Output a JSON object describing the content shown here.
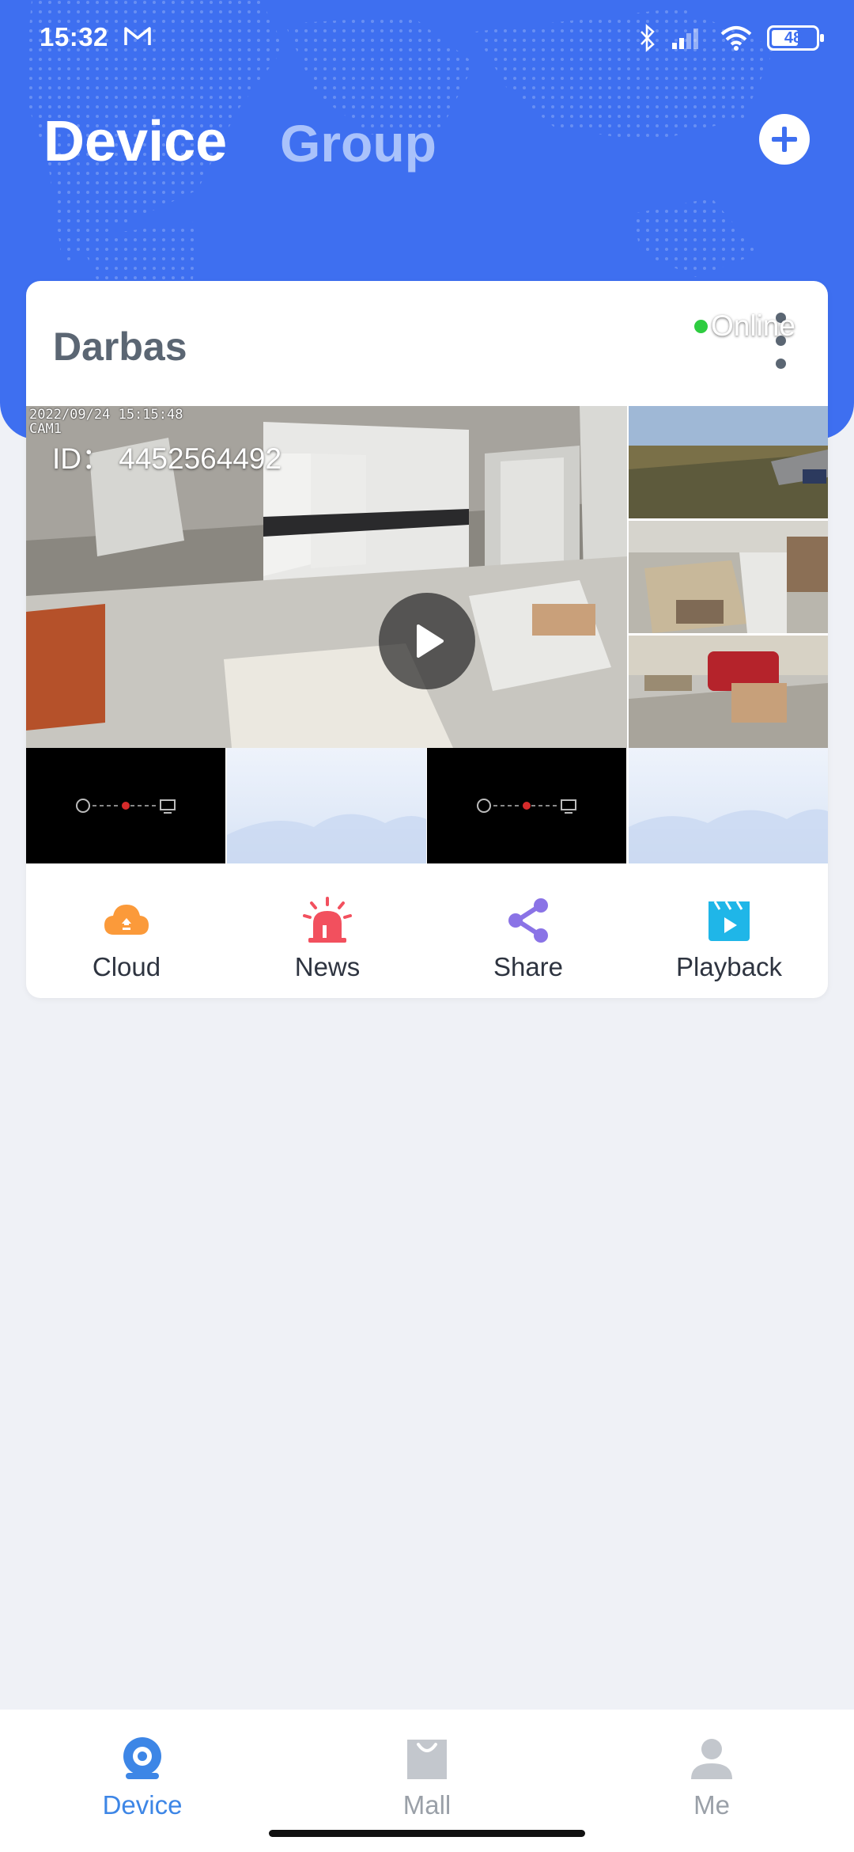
{
  "status_bar": {
    "time": "15:32",
    "battery": "48"
  },
  "header": {
    "tab_device": "Device",
    "tab_group": "Group",
    "add_icon": "plus-circle-icon"
  },
  "device_card": {
    "title": "Darbas",
    "main_camera": {
      "timestamp": "2022/09/24 15:15:48",
      "cam_label": "CAM1",
      "id_text": "ID： 4452564492",
      "status": "Online"
    },
    "actions": [
      {
        "label": "Cloud",
        "icon": "cloud-upload-icon",
        "color": "#fb9a3a"
      },
      {
        "label": "News",
        "icon": "alarm-siren-icon",
        "color": "#f2505e"
      },
      {
        "label": "Share",
        "icon": "share-icon",
        "color": "#8a73e6"
      },
      {
        "label": "Playback",
        "icon": "playback-video-icon",
        "color": "#1fb6e8"
      }
    ]
  },
  "bottom_nav": {
    "items": [
      {
        "label": "Device",
        "icon": "camera-icon",
        "active": true
      },
      {
        "label": "Mall",
        "icon": "shopping-bag-icon",
        "active": false
      },
      {
        "label": "Me",
        "icon": "person-icon",
        "active": false
      }
    ]
  },
  "colors": {
    "accent": "#3e6ff0",
    "active_nav": "#3d86e6",
    "inactive_nav": "#9aa0a8",
    "online": "#2ecc40"
  }
}
